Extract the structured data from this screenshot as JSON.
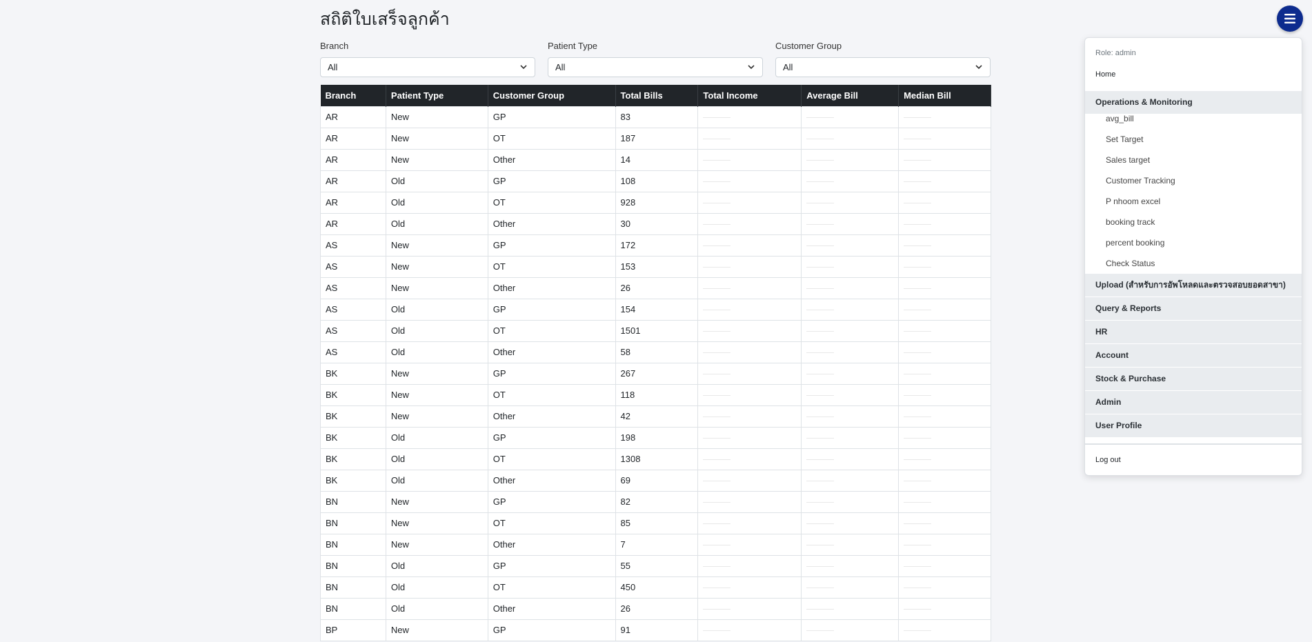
{
  "page": {
    "title": "สถิติใบเสร็จลูกค้า"
  },
  "filters": {
    "branch": {
      "label": "Branch",
      "value": "All"
    },
    "patient_type": {
      "label": "Patient Type",
      "value": "All"
    },
    "customer_group": {
      "label": "Customer Group",
      "value": "All"
    }
  },
  "table": {
    "headers": [
      "Branch",
      "Patient Type",
      "Customer Group",
      "Total Bills",
      "Total Income",
      "Average Bill",
      "Median Bill"
    ],
    "rows": [
      [
        "AR",
        "New",
        "GP",
        "83"
      ],
      [
        "AR",
        "New",
        "OT",
        "187"
      ],
      [
        "AR",
        "New",
        "Other",
        "14"
      ],
      [
        "AR",
        "Old",
        "GP",
        "108"
      ],
      [
        "AR",
        "Old",
        "OT",
        "928"
      ],
      [
        "AR",
        "Old",
        "Other",
        "30"
      ],
      [
        "AS",
        "New",
        "GP",
        "172"
      ],
      [
        "AS",
        "New",
        "OT",
        "153"
      ],
      [
        "AS",
        "New",
        "Other",
        "26"
      ],
      [
        "AS",
        "Old",
        "GP",
        "154"
      ],
      [
        "AS",
        "Old",
        "OT",
        "1501"
      ],
      [
        "AS",
        "Old",
        "Other",
        "58"
      ],
      [
        "BK",
        "New",
        "GP",
        "267"
      ],
      [
        "BK",
        "New",
        "OT",
        "118"
      ],
      [
        "BK",
        "New",
        "Other",
        "42"
      ],
      [
        "BK",
        "Old",
        "GP",
        "198"
      ],
      [
        "BK",
        "Old",
        "OT",
        "1308"
      ],
      [
        "BK",
        "Old",
        "Other",
        "69"
      ],
      [
        "BN",
        "New",
        "GP",
        "82"
      ],
      [
        "BN",
        "New",
        "OT",
        "85"
      ],
      [
        "BN",
        "New",
        "Other",
        "7"
      ],
      [
        "BN",
        "Old",
        "GP",
        "55"
      ],
      [
        "BN",
        "Old",
        "OT",
        "450"
      ],
      [
        "BN",
        "Old",
        "Other",
        "26"
      ],
      [
        "BP",
        "New",
        "GP",
        "91"
      ]
    ]
  },
  "menu": {
    "button_icon": "hamburger-icon",
    "role": "Role: admin",
    "home": "Home",
    "operations": {
      "label": "Operations & Monitoring",
      "items": [
        "avg_bill",
        "Set Target",
        "Sales target",
        "Customer Tracking",
        "P nhoom excel",
        "booking track",
        "percent booking",
        "Check Status"
      ]
    },
    "groups": [
      "Upload (สำหรับการอัพโหลดและตรวจสอบยอดสาขา)",
      "Query & Reports",
      "HR",
      "Account",
      "Stock & Purchase",
      "Admin",
      "User Profile"
    ],
    "logout": "Log out"
  },
  "colors": {
    "header_bg": "#212529",
    "menu_button": "#0d2b8e",
    "page_bg": "#f4f5f8"
  }
}
